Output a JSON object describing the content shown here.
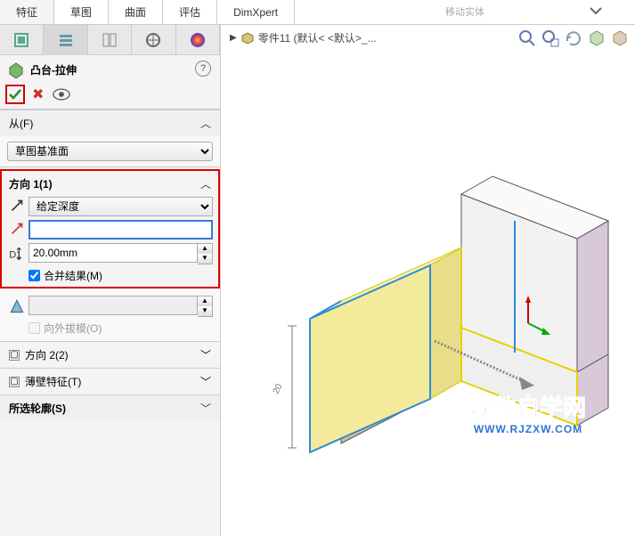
{
  "ribbon": {
    "tabs": [
      "特征",
      "草图",
      "曲面",
      "评估",
      "DimXpert"
    ],
    "toolbar_hint": "移动实体"
  },
  "pm": {
    "title": "凸台-拉伸",
    "help": "?",
    "from": {
      "label": "从(F)",
      "value": "草图基准面"
    },
    "dir1": {
      "label": "方向 1(1)",
      "end_condition": "给定深度",
      "selection": "",
      "depth": "20.00mm",
      "merge": "合并结果(M)"
    },
    "draft": {
      "outward": "向外拔模(O)"
    },
    "dir2": {
      "label": "方向 2(2)"
    },
    "thin": {
      "label": "薄壁特征(T)"
    },
    "contours": {
      "label": "所选轮廓(S)"
    }
  },
  "viewport": {
    "breadcrumb": "零件11  (默认< <默认>_...",
    "watermark_title": "软件自学网",
    "watermark_url": "WWW.RJZXW.COM"
  }
}
